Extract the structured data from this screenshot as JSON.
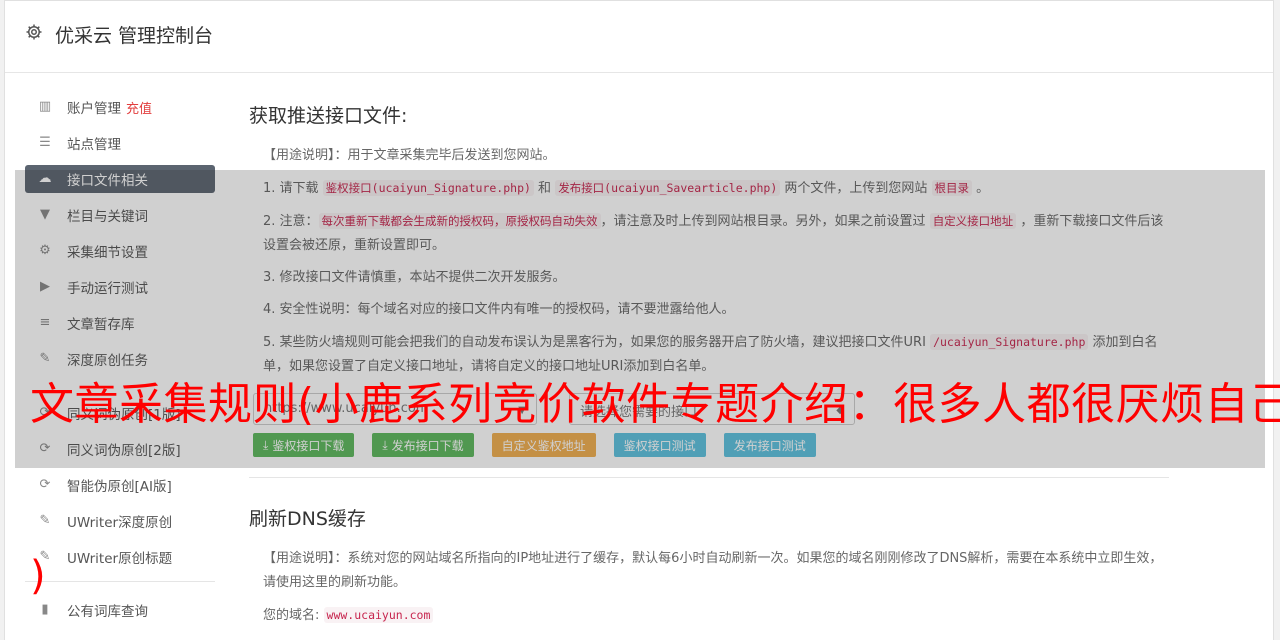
{
  "header": {
    "icon": "gear-icon",
    "title": "优采云 管理控制台"
  },
  "sidebar": {
    "items": [
      {
        "label": "账户管理",
        "icon": "bar-chart-icon",
        "badge": "充值"
      },
      {
        "label": "站点管理",
        "icon": "server-icon"
      },
      {
        "label": "接口文件相关",
        "icon": "cloud-upload-icon",
        "active": true
      },
      {
        "label": "栏目与关键词",
        "icon": "filter-icon"
      },
      {
        "label": "采集细节设置",
        "icon": "cogs-icon"
      },
      {
        "label": "手动运行测试",
        "icon": "play-icon"
      },
      {
        "label": "文章暂存库",
        "icon": "database-icon"
      },
      {
        "label": "深度原创任务",
        "icon": "edit-icon"
      },
      {
        "label": "同义词伪原创[1版]",
        "icon": "refresh-icon"
      },
      {
        "label": "同义词伪原创[2版]",
        "icon": "refresh-icon"
      },
      {
        "label": "智能伪原创[AI版]",
        "icon": "refresh-icon"
      },
      {
        "label": "UWriter深度原创",
        "icon": "edit-icon"
      },
      {
        "label": "UWriter原创标题",
        "icon": "edit-icon"
      },
      {
        "label": "公有词库查询",
        "icon": "book-icon"
      }
    ]
  },
  "section1": {
    "title": "获取推送接口文件:",
    "usage": "【用途说明】：用于文章采集完毕后发送到您网站。",
    "p1": {
      "a": "1. 请下载 ",
      "code1": "鉴权接口(ucaiyun_Signature.php)",
      "b": " 和 ",
      "code2": "发布接口(ucaiyun_Savearticle.php)",
      "c": " 两个文件，上传到您网站 ",
      "code3": "根目录",
      "d": " 。"
    },
    "p2": {
      "a": "2. 注意：",
      "code1": "每次重新下载都会生成新的授权码，原授权码自动失效",
      "b": "，请注意及时上传到网站根目录。另外，如果之前设置过 ",
      "code2": "自定义接口地址",
      "c": " ，重新下载接口文件后该设置会被还原，重新设置即可。"
    },
    "p3": "3. 修改接口文件请慎重，本站不提供二次开发服务。",
    "p4": "4. 安全性说明：每个域名对应的接口文件内有唯一的授权码，请不要泄露给他人。",
    "p5": {
      "a": "5. 某些防火墙规则可能会把我们的自动发布误认为是黑客行为，如果您的服务器开启了防火墙，建议把接口文件URI ",
      "code1": "/ucaiyun_Signature.php",
      "b": " 添加到白名单，如果您设置了自定义接口地址，请将自定义的接口地址URI添加到白名单。"
    },
    "site_select": "https://www.ucaiyun.com",
    "api_select": "请选择您需要的接口",
    "buttons": {
      "download_auth": "鉴权接口下载",
      "download_publish": "发布接口下载",
      "custom_auth_url": "自定义鉴权地址",
      "test_auth": "鉴权接口测试",
      "test_publish": "发布接口测试"
    }
  },
  "section2": {
    "title": "刷新DNS缓存",
    "usage": "【用途说明】：系统对您的网站域名所指向的IP地址进行了缓存，默认每6小时自动刷新一次。如果您的域名刚刚修改了DNS解析，需要在本系统中立即生效，请使用这里的刷新功能。",
    "domain_label": "您的域名:",
    "domain_value": "www.ucaiyun.com"
  },
  "overlay": {
    "banner": "文章采集规则(小鹿系列竞价软件专题介绍：很多人都很厌烦自己",
    "paren": ")"
  },
  "colors": {
    "active_nav": "#5b6470",
    "green": "#5cb85c",
    "orange": "#f0ad4e",
    "blue": "#5bc0de",
    "banner": "#ff0000",
    "code": "#c7254e"
  }
}
